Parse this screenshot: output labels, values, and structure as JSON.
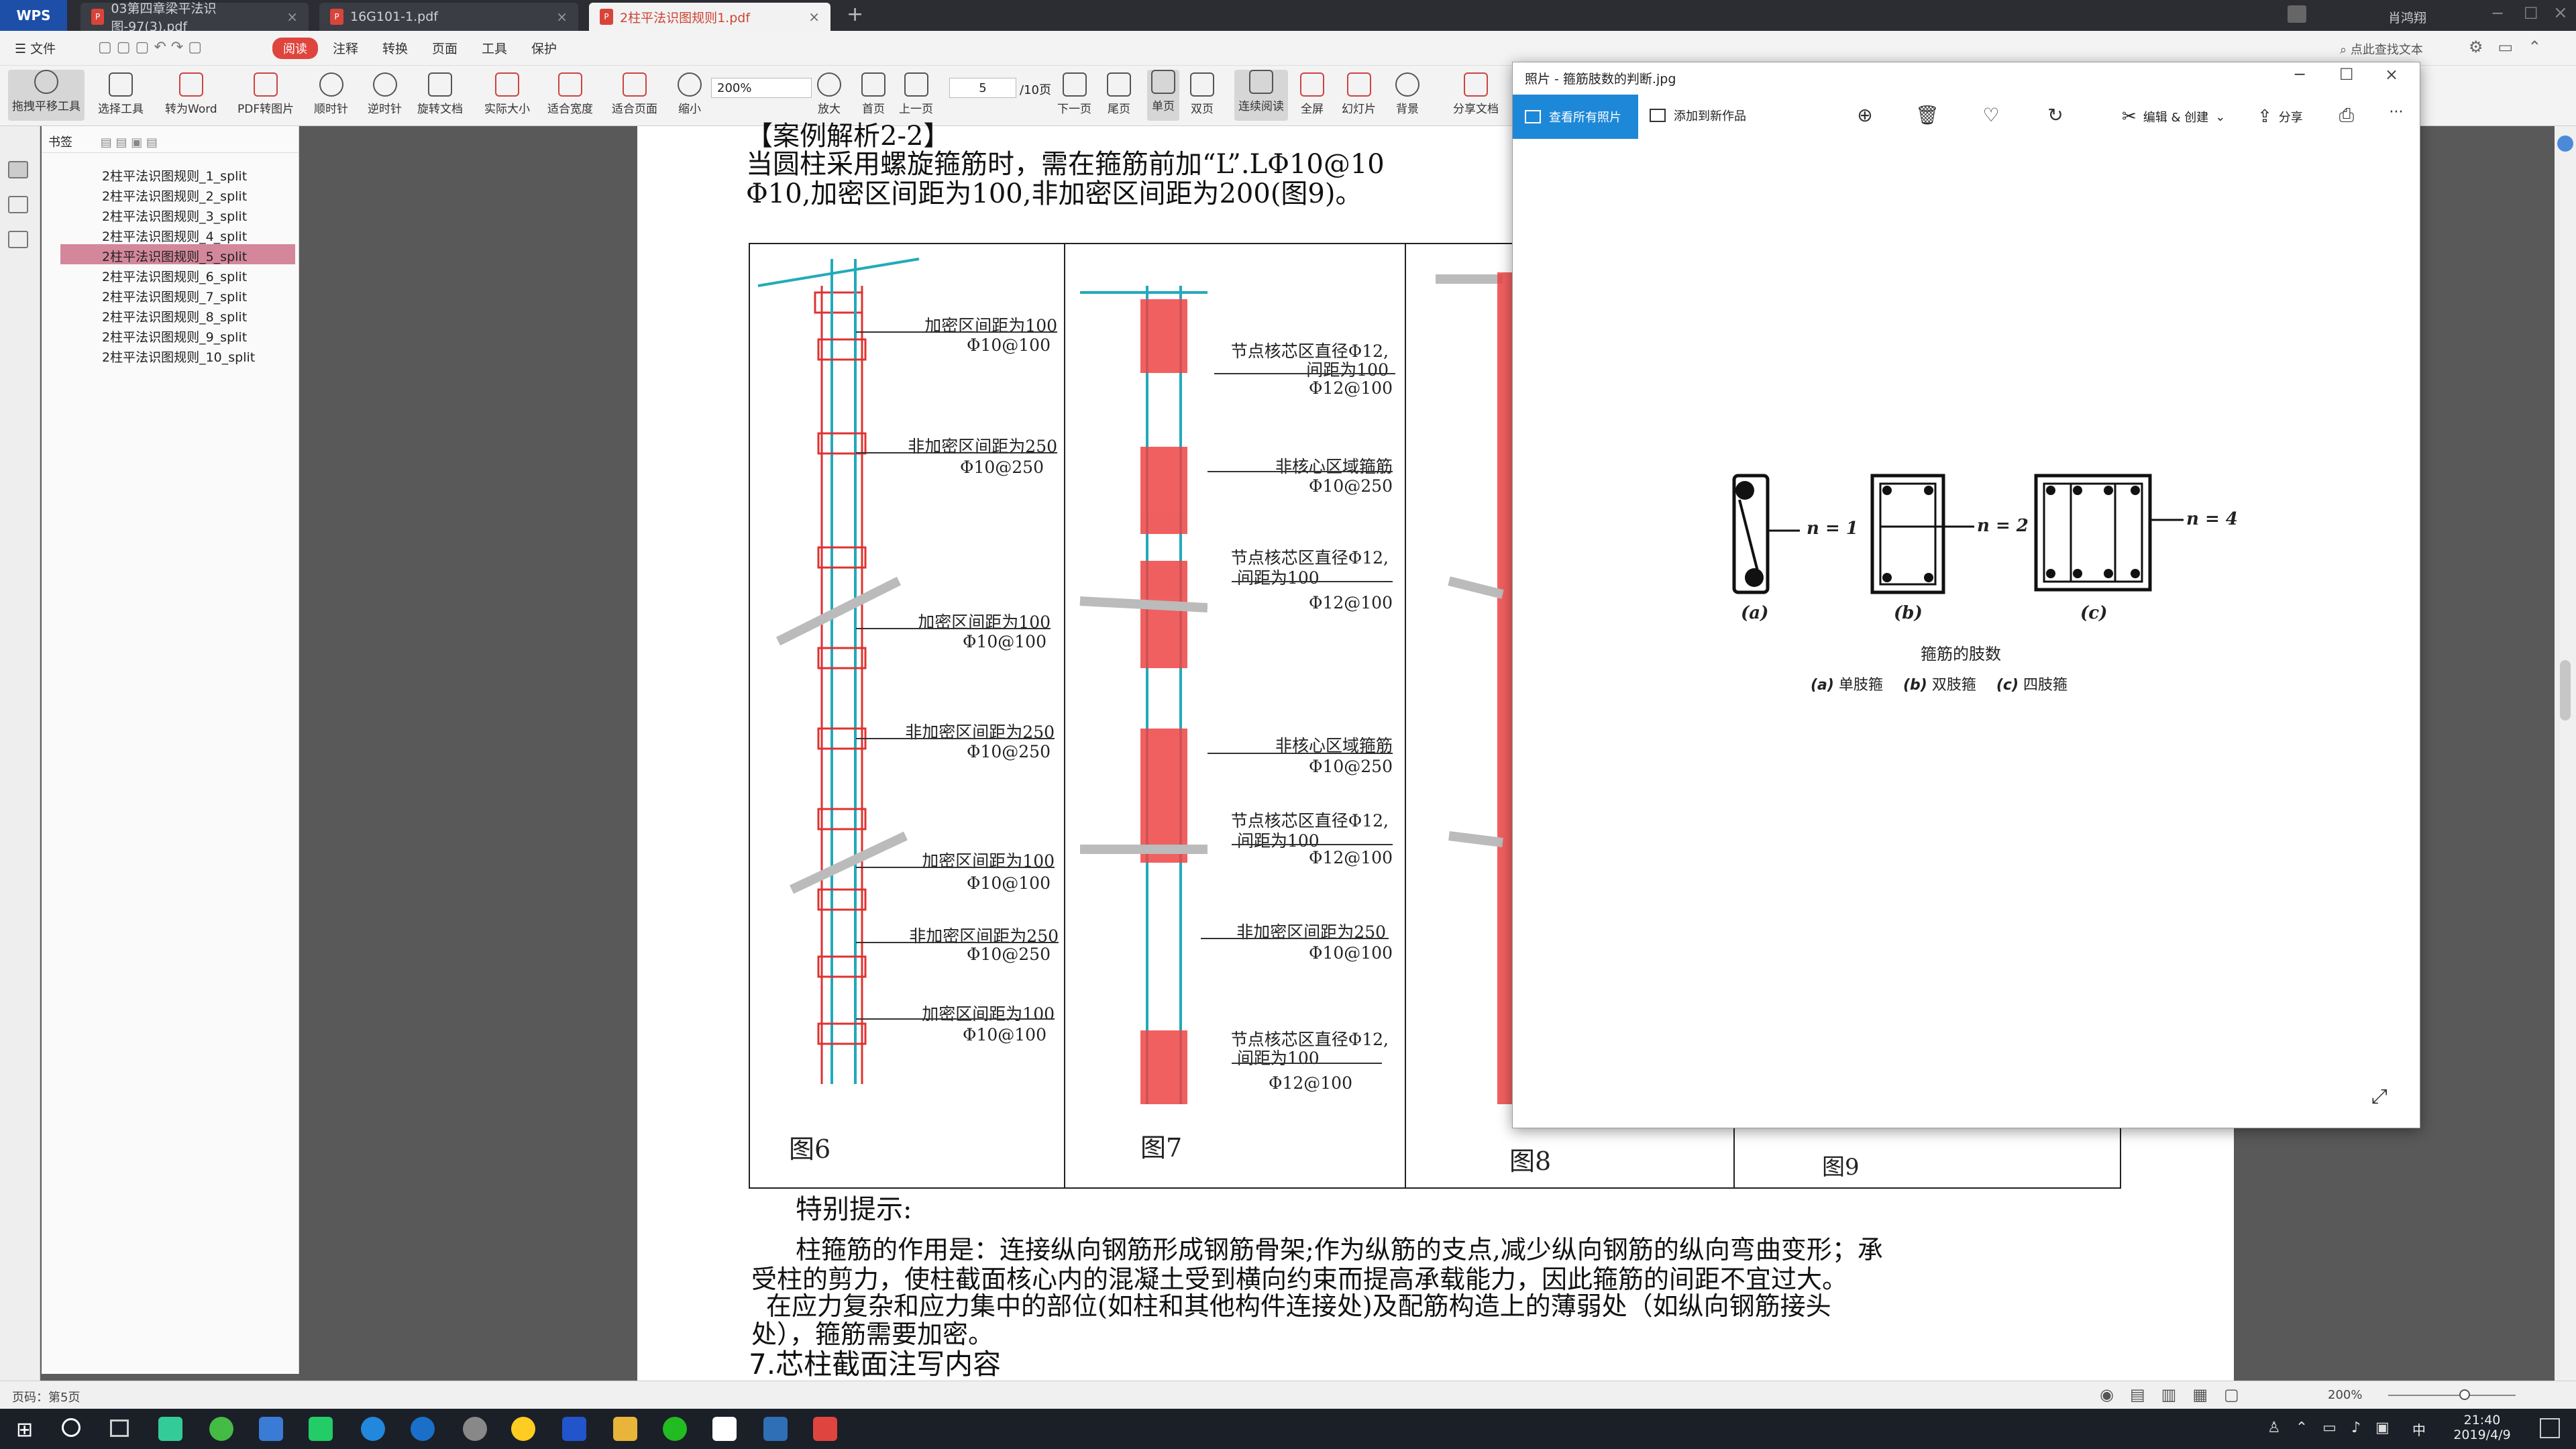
{
  "titlebar": {
    "app": "WPS",
    "tabs": [
      {
        "label": "03第四章梁平法识图-97(3).pdf"
      },
      {
        "label": "16G101-1.pdf"
      },
      {
        "label": "2柱平法识图规则1.pdf"
      }
    ],
    "add_tab": "+",
    "user": "肖鸿翔"
  },
  "menubar": {
    "file": "文件",
    "read": "阅读",
    "items": [
      "注释",
      "转换",
      "页面",
      "工具",
      "保护"
    ],
    "search": "点此查找文本"
  },
  "toolbar": {
    "buttons": [
      "拖拽平移工具",
      "选择工具",
      "转为Word",
      "PDF转图片",
      "顺时针",
      "逆时针",
      "旋转文档",
      "实际大小",
      "适合宽度",
      "适合页面",
      "缩小"
    ],
    "zoom": "200%",
    "zoom_in": "放大",
    "first": "首页",
    "prev": "上一页",
    "page": "5",
    "page_total": "/10页",
    "next": "下一页",
    "last": "尾页",
    "single": "单页",
    "double": "双页",
    "continuous": "连续阅读",
    "fullscreen": "全屏",
    "slides": "幻灯片",
    "background": "背景",
    "share": "分享文档"
  },
  "bookmarks": {
    "header": "书签",
    "items": [
      "2柱平法识图规则_1_split",
      "2柱平法识图规则_2_split",
      "2柱平法识图规则_3_split",
      "2柱平法识图规则_4_split",
      "2柱平法识图规则_5_split",
      "2柱平法识图规则_6_split",
      "2柱平法识图规则_7_split",
      "2柱平法识图规则_8_split",
      "2柱平法识图规则_9_split",
      "2柱平法识图规则_10_split"
    ],
    "selected_index": 4
  },
  "document": {
    "heading": "【案例解析2-2】",
    "line1": "当圆柱采用螺旋箍筋时，需在箍筋前加“L”.LΦ10@10",
    "line2": "Φ10,加密区间距为100,非加密区间距为200(图9)。",
    "fig6_annos": [
      {
        "a": "加密区间距为100",
        "b": "Φ10@100"
      },
      {
        "a": "非加密区间距为250",
        "b": "Φ10@250"
      },
      {
        "a": "加密区间距为100",
        "b": "Φ10@100"
      },
      {
        "a": "非加密区间距为250",
        "b": "Φ10@250"
      },
      {
        "a": "加密区间距为100",
        "b": "Φ10@100"
      },
      {
        "a": "非加密区间距为250",
        "b": "Φ10@250"
      },
      {
        "a": "加密区间距为100",
        "b": "Φ10@100"
      }
    ],
    "fig7_annos": [
      {
        "a": "节点核芯区直径Φ12,",
        "c": "间距为100",
        "b": "Φ12@100"
      },
      {
        "a": "非核心区域箍筋",
        "b": "Φ10@250"
      },
      {
        "a": "节点核芯区直径Φ12,",
        "c": "间距为100",
        "b": "Φ12@100"
      },
      {
        "a": "非核心区域箍筋",
        "b": "Φ10@250"
      },
      {
        "a": "节点核芯区直径Φ12,",
        "c": "间距为100",
        "b": "Φ12@100"
      },
      {
        "a": "非加密区间距为250",
        "b": "Φ10@100"
      },
      {
        "a": "节点核芯区直径Φ12,",
        "c": "间距为100",
        "b": "Φ12@100"
      }
    ],
    "captions": [
      "图6",
      "图7",
      "图8",
      "图9"
    ],
    "tip_title": "特别提示:",
    "para1a": "柱箍筋的作用是：连接纵向钢筋形成钢筋骨架;作为纵筋的支点,减少纵向钢筋的纵向弯曲变形；承",
    "para1b": "受柱的剪力，使柱截面核心内的混凝土受到横向约束而提高承载能力，因此箍筋的间距不宜过大。",
    "para2a": "在应力复杂和应力集中的部位(如柱和其他构件连接处)及配筋构造上的薄弱处（如纵向钢筋接头",
    "para2b": "处），箍筋需要加密。",
    "section": "7.芯柱截面注写内容"
  },
  "viewer": {
    "title": "照片 - 箍筋肢数的判断.jpg",
    "view_all": "查看所有照片",
    "add_to": "添加到新作品",
    "edit": "编辑 & 创建",
    "share": "分享",
    "more": "···",
    "image": {
      "labels": [
        "(a)",
        "(b)",
        "(c)"
      ],
      "n_labels": [
        "n = 1",
        "n = 2",
        "n = 4"
      ],
      "caption": "箍筋的肢数",
      "legend": [
        {
          "k": "(a)",
          "v": "单肢箍"
        },
        {
          "k": "(b)",
          "v": "双肢箍"
        },
        {
          "k": "(c)",
          "v": "四肢箍"
        }
      ]
    }
  },
  "statusbar": {
    "page": "页码：第5页",
    "zoom": "200%"
  },
  "taskbar": {
    "time": "21:40",
    "date": "2019/4/9",
    "lang": "中"
  }
}
